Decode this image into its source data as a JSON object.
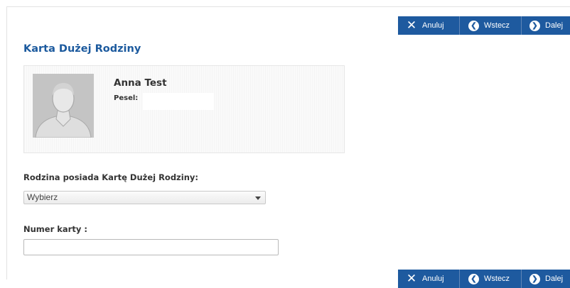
{
  "actions": {
    "cancel_label": "Anuluj",
    "back_label": "Wstecz",
    "next_label": "Dalej"
  },
  "page": {
    "title": "Karta Dużej Rodziny"
  },
  "profile": {
    "name": "Anna Test",
    "pesel_label": "Pesel:",
    "pesel_value": ""
  },
  "form": {
    "has_card_label": "Rodzina posiada Kartę Dużej Rodziny:",
    "has_card_selected": "Wybierz",
    "card_number_label": "Numer karty :",
    "card_number_value": ""
  },
  "colors": {
    "accent": "#1e5a9f",
    "title": "#1c5a9e"
  },
  "icons": {
    "cancel": "close-icon",
    "back": "chevron-left-circle-icon",
    "next": "chevron-right-circle-icon",
    "select": "caret-down-icon",
    "avatar": "user-silhouette-icon"
  }
}
